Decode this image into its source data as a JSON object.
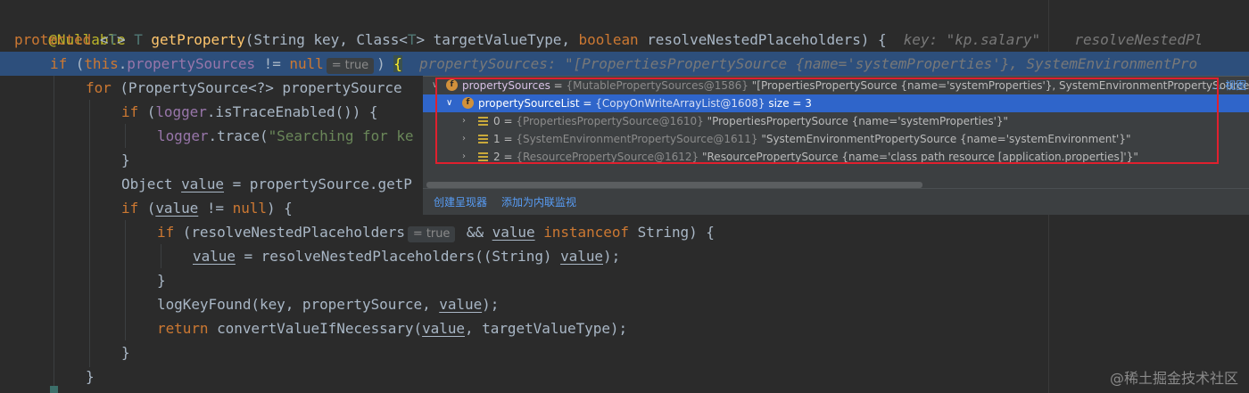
{
  "code": {
    "l1": "@Nullable",
    "l2_kw": "protected",
    "l2_a": " <",
    "l2_tp1": "T",
    "l2_b": "> ",
    "l2_tp2": "T",
    "l2_sp": " ",
    "l2_fn": "getProperty",
    "l2_c": "(String key, Class<",
    "l2_tp3": "T",
    "l2_d": "> targetValueType, ",
    "l2_kw2": "boolean",
    "l2_e": " resolveNestedPlaceholders) {",
    "l2_hint": "  key: \"kp.salary\"    resolveNestedPl",
    "l3_kw": "if",
    "l3_a": " (",
    "l3_kw2": "this",
    "l3_b": ".",
    "l3_field": "propertySources",
    "l3_c": " != ",
    "l3_kw3": "null",
    "l3_inline": "= true",
    "l3_d": ") ",
    "l3_brace": "{",
    "l3_hint": "  propertySources: \"[PropertiesPropertySource {name='systemProperties'}, SystemEnvironmentPro",
    "l4_kw": "for",
    "l4_a": " (PropertySource<?> propertySource",
    "l5_kw": "if",
    "l5_a": " (",
    "l5_field": "logger",
    "l5_b": ".isTraceEnabled()) {",
    "l6_field": "logger",
    "l6_a": ".trace(",
    "l6_str": "\"Searching for ke",
    "l7": "}",
    "l8_a": "Object ",
    "l8_var": "value",
    "l8_b": " = propertySource.getP",
    "l9_kw": "if",
    "l9_a": " (",
    "l9_var": "value",
    "l9_b": " != ",
    "l9_kw2": "null",
    "l9_c": ") {",
    "l10_kw": "if",
    "l10_a": " (resolveNestedPlaceholders",
    "l10_inline": "= true",
    "l10_b": " && ",
    "l10_var": "value",
    "l10_sp": " ",
    "l10_kw2": "instanceof",
    "l10_c": " String) {",
    "l11_var": "value",
    "l11_a": " = resolveNestedPlaceholders((String) ",
    "l11_var2": "value",
    "l11_b": ");",
    "l12": "}",
    "l13_a": "logKeyFound(key, propertySource, ",
    "l13_var": "value",
    "l13_b": ");",
    "l14_kw": "return",
    "l14_a": " convertValueIfNecessary(",
    "l14_var": "value",
    "l14_b": ", targetValueType);",
    "l15": "}",
    "l16": "}"
  },
  "debug_popup": {
    "root": {
      "name": "propertySources",
      "eq": " = ",
      "type": "{MutablePropertySources@1586}",
      "value": " \"[PropertiesPropertySource {name='systemProperties'}, SystemEnvironmentPropertySource {",
      "view": "... 视图"
    },
    "child": {
      "name": "propertySourceList",
      "eq": " = ",
      "type": "{CopyOnWriteArrayList@1608}",
      "size": "  size = 3"
    },
    "items": [
      {
        "index": "0",
        "eq": " = ",
        "type": "{PropertiesPropertySource@1610}",
        "value": " \"PropertiesPropertySource {name='systemProperties'}\""
      },
      {
        "index": "1",
        "eq": " = ",
        "type": "{SystemEnvironmentPropertySource@1611}",
        "value": " \"SystemEnvironmentPropertySource {name='systemEnvironment'}\""
      },
      {
        "index": "2",
        "eq": " = ",
        "type": "{ResourcePropertySource@1612}",
        "value": " \"ResourcePropertySource {name='class path resource [application.properties]'}\""
      }
    ],
    "footer": {
      "create_renderer": "创建呈现器",
      "add_inline_watch": "添加为内联监视"
    }
  },
  "icons": {
    "field_badge": "f",
    "expand": "expand-chevron-icon",
    "collapse": "collapse-chevron-icon",
    "list": "list-item-icon"
  },
  "colors": {
    "background": "#2b2b2b",
    "keyword": "#cc7832",
    "function": "#ffc66d",
    "field": "#9876aa",
    "string": "#6a8759",
    "annotation": "#bbb529",
    "selection": "#2f65ca",
    "highlight": "#2d4f7c",
    "red_box": "#e0202e"
  },
  "watermark": "@稀土掘金技术社区"
}
